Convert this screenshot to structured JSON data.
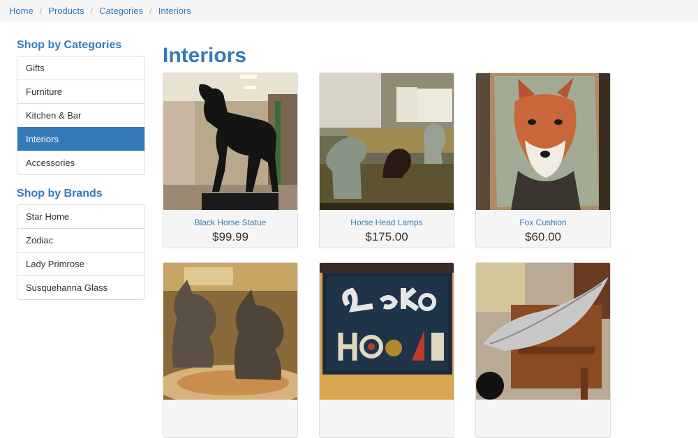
{
  "breadcrumb": [
    "Home",
    "Products",
    "Categories",
    "Interiors"
  ],
  "sidebar": {
    "categories_heading": "Shop by Categories",
    "categories": [
      "Gifts",
      "Furniture",
      "Kitchen & Bar",
      "Interiors",
      "Accessories"
    ],
    "active_category": "Interiors",
    "brands_heading": "Shop by Brands",
    "brands": [
      "Star Home",
      "Zodiac",
      "Lady Primrose",
      "Susquehanna Glass"
    ]
  },
  "page_title": "Interiors",
  "products": [
    {
      "name": "Black Horse Statue",
      "price": "$99.99",
      "image": "black-horse-statue-photo"
    },
    {
      "name": "Horse Head Lamps",
      "price": "$175.00",
      "image": "horse-head-lamps-photo"
    },
    {
      "name": "Fox Cushion",
      "price": "$60.00",
      "image": "fox-cushion-photo"
    },
    {
      "name": "",
      "price": "",
      "image": "horse-head-bookends-photo"
    },
    {
      "name": "",
      "price": "",
      "image": "lake-house-rug-photo"
    },
    {
      "name": "",
      "price": "",
      "image": "silver-leaf-tray-photo"
    }
  ],
  "colors": {
    "accent": "#337ab7",
    "breadcrumb_bg": "#f5f5f5",
    "card_bg": "#f5f5f5"
  }
}
